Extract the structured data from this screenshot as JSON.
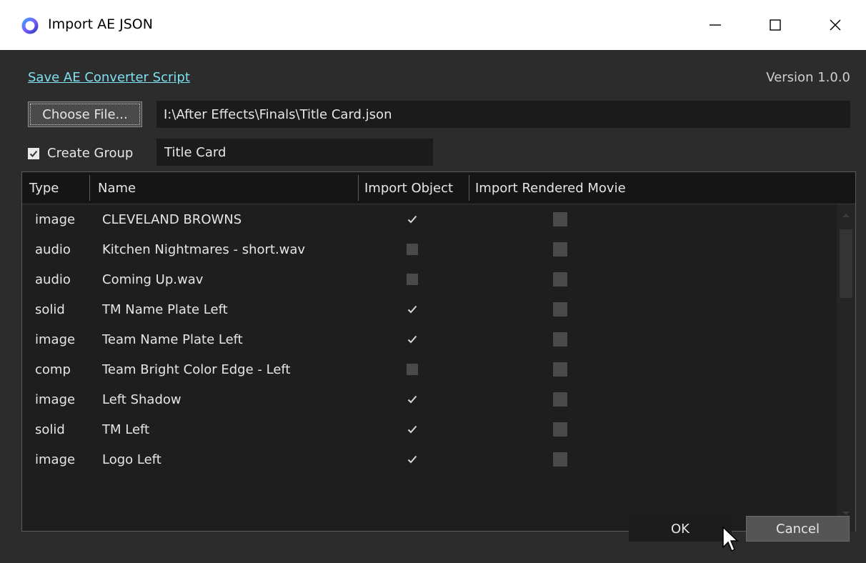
{
  "window": {
    "title": "Import AE JSON",
    "minimize_label": "—",
    "maximize_label": "☐",
    "close_label": "✕"
  },
  "header": {
    "save_link": "Save AE Converter Script",
    "version": "Version 1.0.0"
  },
  "file": {
    "choose_label": "Choose File...",
    "path": "I:\\After Effects\\Finals\\Title Card.json"
  },
  "group": {
    "create_group_label": "Create Group",
    "create_group_checked": true,
    "group_name": "Title Card"
  },
  "table": {
    "columns": [
      "Type",
      "Name",
      "Import Object",
      "Import Rendered Movie"
    ],
    "rows": [
      {
        "type": "image",
        "name": "CLEVELAND BROWNS",
        "import_object": true,
        "import_movie": false
      },
      {
        "type": "audio",
        "name": "Kitchen Nightmares - short.wav",
        "import_object": false,
        "import_movie": false
      },
      {
        "type": "audio",
        "name": "Coming Up.wav",
        "import_object": false,
        "import_movie": false
      },
      {
        "type": "solid",
        "name": "TM Name Plate Left",
        "import_object": true,
        "import_movie": false
      },
      {
        "type": "image",
        "name": "Team Name Plate Left",
        "import_object": true,
        "import_movie": false
      },
      {
        "type": "comp",
        "name": "Team Bright Color Edge - Left",
        "import_object": false,
        "import_movie": false
      },
      {
        "type": "image",
        "name": "Left Shadow",
        "import_object": true,
        "import_movie": false
      },
      {
        "type": "solid",
        "name": "TM Left",
        "import_object": true,
        "import_movie": false
      },
      {
        "type": "image",
        "name": "Logo Left",
        "import_object": true,
        "import_movie": false
      }
    ]
  },
  "footer": {
    "ok_label": "OK",
    "cancel_label": "Cancel"
  },
  "colors": {
    "background": "#2c2c2c",
    "link": "#7ee0f0",
    "field_bg": "#1b1b1b"
  }
}
